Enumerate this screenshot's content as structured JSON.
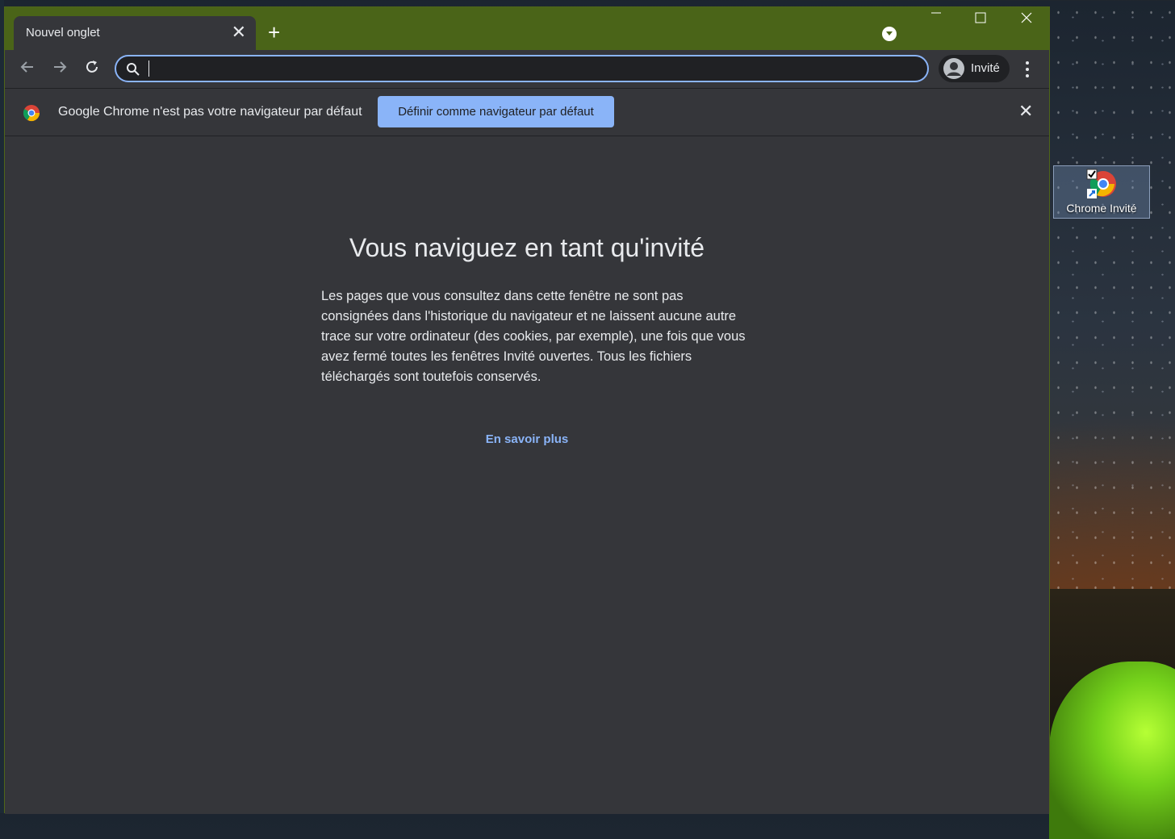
{
  "desktop": {
    "shortcut_label": "Chrome Invité"
  },
  "browser": {
    "tab_title": "Nouvel onglet",
    "new_tab_symbol": "+",
    "close_symbol": "✕",
    "minimize_symbol": "—",
    "maximize_symbol": "☐",
    "omnibox_value": "",
    "profile_label": "Invité",
    "accent_color": "#8ab4f8",
    "frame_color": "#4a6418",
    "background_color": "#35363a"
  },
  "infobar": {
    "message": "Google Chrome n'est pas votre navigateur par défaut",
    "button_label": "Définir comme navigateur par défaut"
  },
  "guest_page": {
    "title": "Vous naviguez en tant qu'invité",
    "body": "Les pages que vous consultez dans cette fenêtre ne sont pas consignées dans l'historique du navigateur et ne laissent aucune autre trace sur votre ordinateur (des cookies, par exemple), une fois que vous avez fermé toutes les fenêtres Invité ouvertes. Tous les fichiers téléchargés sont toutefois conservés.",
    "learn_more": "En savoir plus"
  }
}
